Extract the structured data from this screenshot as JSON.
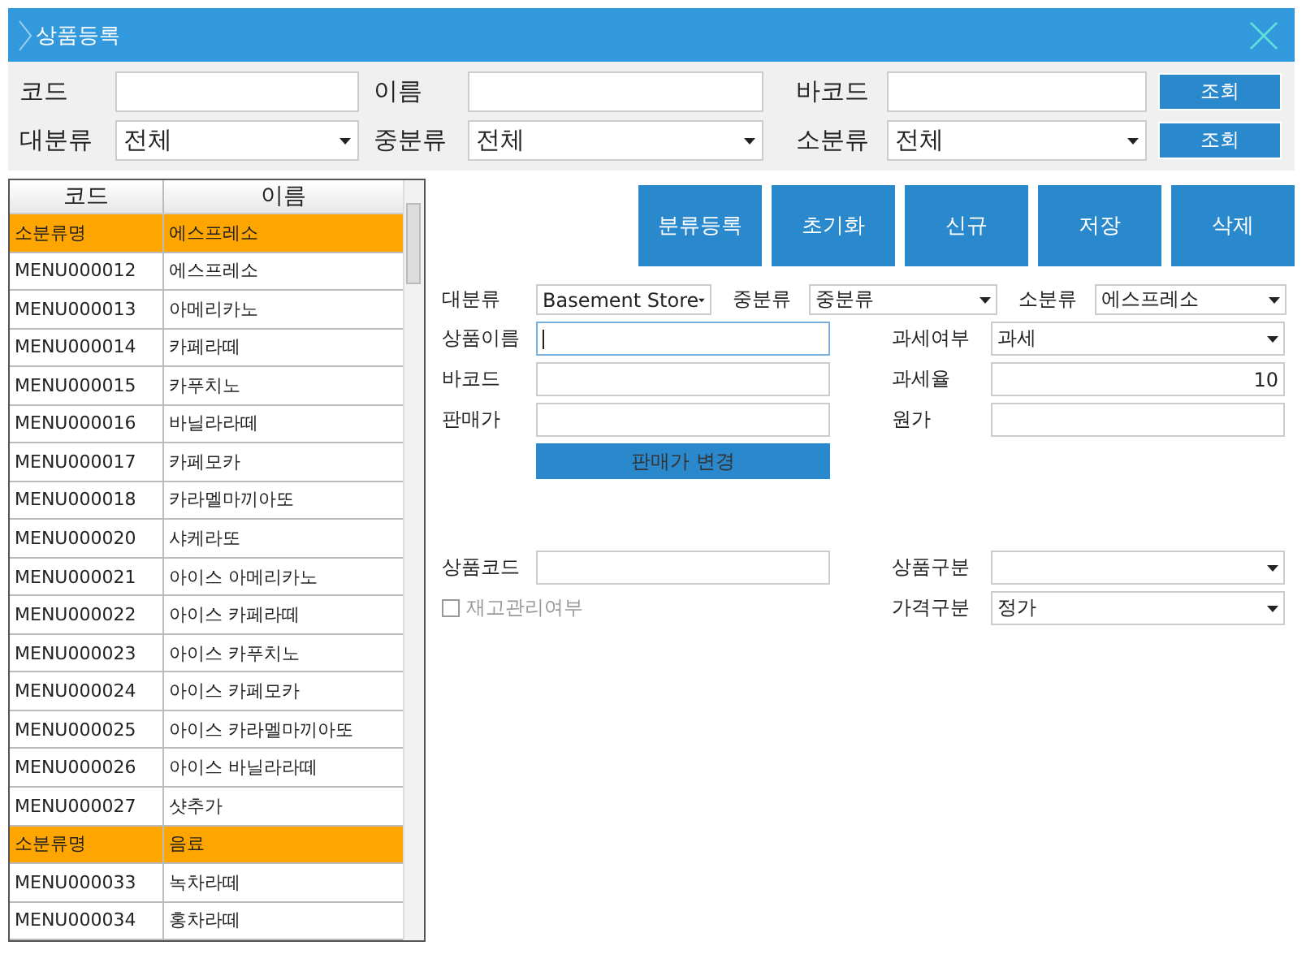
{
  "window": {
    "title": "상품등록"
  },
  "search": {
    "rows": [
      {
        "fields": [
          {
            "kind": "text",
            "label": "코드"
          },
          {
            "kind": "text",
            "label": "이름"
          },
          {
            "kind": "text",
            "label": "바코드"
          }
        ],
        "button": "조회"
      },
      {
        "fields": [
          {
            "kind": "select",
            "label": "대분류",
            "value": "전체"
          },
          {
            "kind": "select",
            "label": "중분류",
            "value": "전체"
          },
          {
            "kind": "select",
            "label": "소분류",
            "value": "전체"
          }
        ],
        "button": "조회"
      }
    ]
  },
  "table": {
    "columns": [
      "코드",
      "이름"
    ],
    "rows": [
      {
        "kind": "group",
        "cells": [
          "소분류명",
          "에스프레소"
        ]
      },
      {
        "kind": "item",
        "cells": [
          "MENU000012",
          "에스프레소"
        ]
      },
      {
        "kind": "item",
        "cells": [
          "MENU000013",
          "아메리카노"
        ]
      },
      {
        "kind": "item",
        "cells": [
          "MENU000014",
          "카페라떼"
        ]
      },
      {
        "kind": "item",
        "cells": [
          "MENU000015",
          "카푸치노"
        ]
      },
      {
        "kind": "item",
        "cells": [
          "MENU000016",
          "바닐라라떼"
        ]
      },
      {
        "kind": "item",
        "cells": [
          "MENU000017",
          "카페모카"
        ]
      },
      {
        "kind": "item",
        "cells": [
          "MENU000018",
          "카라멜마끼아또"
        ]
      },
      {
        "kind": "item",
        "cells": [
          "MENU000020",
          "샤케라또"
        ]
      },
      {
        "kind": "item",
        "cells": [
          "MENU000021",
          "아이스 아메리카노"
        ]
      },
      {
        "kind": "item",
        "cells": [
          "MENU000022",
          "아이스 카페라떼"
        ]
      },
      {
        "kind": "item",
        "cells": [
          "MENU000023",
          "아이스 카푸치노"
        ]
      },
      {
        "kind": "item",
        "cells": [
          "MENU000024",
          "아이스 카페모카"
        ]
      },
      {
        "kind": "item",
        "cells": [
          "MENU000025",
          "아이스 카라멜마끼아또"
        ]
      },
      {
        "kind": "item",
        "cells": [
          "MENU000026",
          "아이스 바닐라라떼"
        ]
      },
      {
        "kind": "item",
        "cells": [
          "MENU000027",
          "샷추가"
        ]
      },
      {
        "kind": "group",
        "cells": [
          "소분류명",
          "음료"
        ]
      },
      {
        "kind": "item",
        "cells": [
          "MENU000033",
          "녹차라떼"
        ]
      },
      {
        "kind": "item",
        "cells": [
          "MENU000034",
          "홍차라떼"
        ]
      }
    ]
  },
  "toolbar": [
    "분류등록",
    "초기화",
    "신규",
    "저장",
    "삭제"
  ],
  "form": {
    "categories": [
      {
        "label": "대분류",
        "value": "Basement Store"
      },
      {
        "label": "중분류",
        "value": "중분류"
      },
      {
        "label": "소분류",
        "value": "에스프레소"
      }
    ],
    "rows": [
      [
        {
          "kind": "text",
          "label": "상품이름",
          "focused": true
        },
        {
          "kind": "select",
          "label": "과세여부",
          "value": "과세"
        }
      ],
      [
        {
          "kind": "text",
          "label": "바코드"
        },
        {
          "kind": "number",
          "label": "과세율",
          "value": "10"
        }
      ],
      [
        {
          "kind": "text",
          "label": "판매가"
        },
        {
          "kind": "text",
          "label": "원가"
        }
      ],
      [
        {
          "kind": "button",
          "label": "판매가 변경"
        }
      ]
    ],
    "lower": [
      [
        {
          "kind": "text",
          "label": "상품코드"
        },
        {
          "kind": "select",
          "label": "상품구분"
        }
      ],
      [
        {
          "kind": "checkbox",
          "label": "재고관리여부",
          "checked": false,
          "disabled": true
        },
        {
          "kind": "select",
          "label": "가격구분",
          "value": "정가"
        }
      ]
    ]
  }
}
